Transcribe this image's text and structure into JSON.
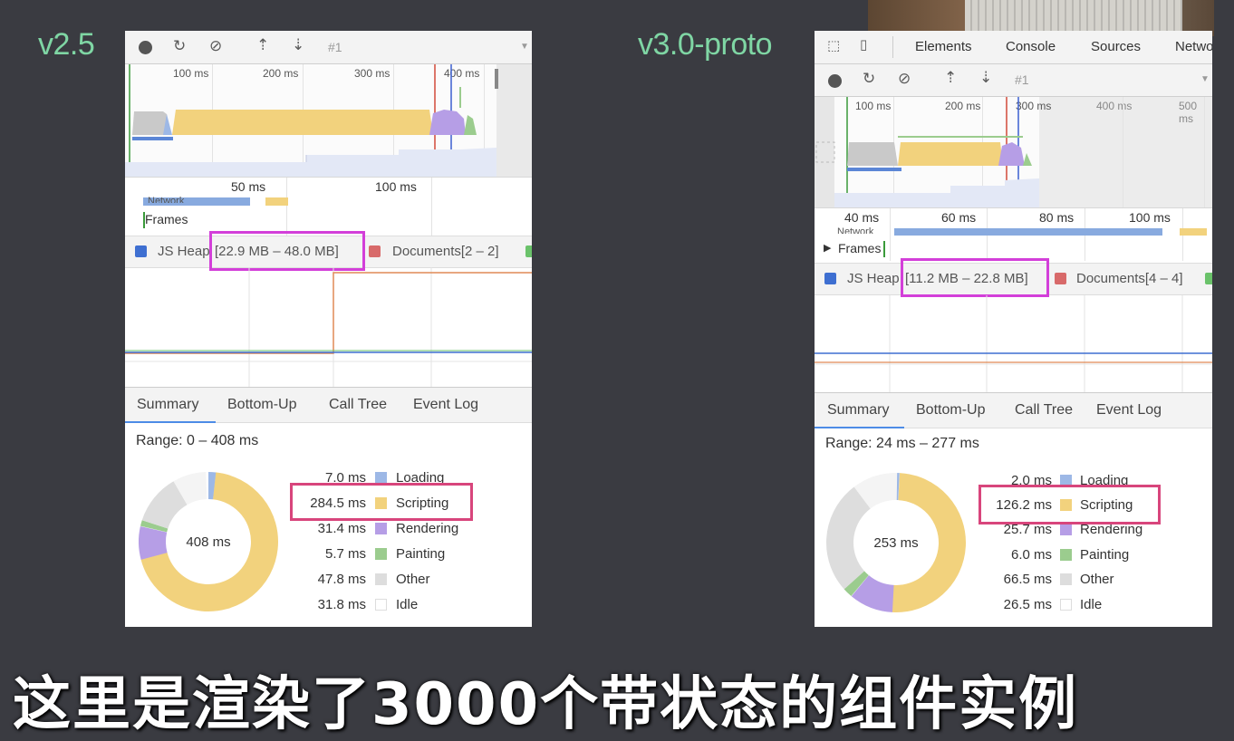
{
  "left": {
    "version": "v2.5",
    "profile": "#1",
    "overview_ticks": [
      "100 ms",
      "200 ms",
      "300 ms",
      "400 ms"
    ],
    "detail_ticks": [
      "50 ms",
      "100 ms"
    ],
    "network_label": "Network",
    "frames_label": "Frames",
    "js_heap_label": "JS Heap",
    "js_heap_range": "[22.9 MB – 48.0 MB]",
    "documents": "Documents[2 – 2]",
    "tabs": [
      "Summary",
      "Bottom-Up",
      "Call Tree",
      "Event Log"
    ],
    "range": "Range: 0 – 408 ms",
    "total": "408 ms",
    "legend": [
      {
        "value": "7.0 ms",
        "label": "Loading",
        "color": "#9db8e6"
      },
      {
        "value": "284.5 ms",
        "label": "Scripting",
        "color": "#f2d27d"
      },
      {
        "value": "31.4 ms",
        "label": "Rendering",
        "color": "#b69ee6"
      },
      {
        "value": "5.7 ms",
        "label": "Painting",
        "color": "#9bcc8e"
      },
      {
        "value": "47.8 ms",
        "label": "Other",
        "color": "#dddddd"
      },
      {
        "value": "31.8 ms",
        "label": "Idle",
        "color": "#ffffff"
      }
    ]
  },
  "right": {
    "version": "v3.0-proto",
    "devtools_tabs": [
      "Elements",
      "Console",
      "Sources",
      "Network"
    ],
    "profile": "#1",
    "overview_ticks": [
      "100 ms",
      "200 ms",
      "300 ms",
      "400 ms",
      "500 ms"
    ],
    "detail_ticks": [
      "40 ms",
      "60 ms",
      "80 ms",
      "100 ms"
    ],
    "network_label": "Network",
    "frames_label": "Frames",
    "js_heap_label": "JS Heap",
    "js_heap_range": "[11.2 MB – 22.8 MB]",
    "documents": "Documents[4 – 4]",
    "tabs": [
      "Summary",
      "Bottom-Up",
      "Call Tree",
      "Event Log"
    ],
    "range": "Range: 24 ms – 277 ms",
    "total": "253 ms",
    "legend": [
      {
        "value": "2.0 ms",
        "label": "Loading",
        "color": "#9db8e6"
      },
      {
        "value": "126.2 ms",
        "label": "Scripting",
        "color": "#f2d27d"
      },
      {
        "value": "25.7 ms",
        "label": "Rendering",
        "color": "#b69ee6"
      },
      {
        "value": "6.0 ms",
        "label": "Painting",
        "color": "#9bcc8e"
      },
      {
        "value": "66.5 ms",
        "label": "Other",
        "color": "#dddddd"
      },
      {
        "value": "26.5 ms",
        "label": "Idle",
        "color": "#ffffff"
      }
    ]
  },
  "caption": "这里是渲染了3000个带状态的组件实例",
  "colors": {
    "background": "#3a3b41",
    "version_text": "#7fd6a4",
    "heap_highlight": "#d33fd9",
    "scripting_highlight": "#d8457c"
  }
}
